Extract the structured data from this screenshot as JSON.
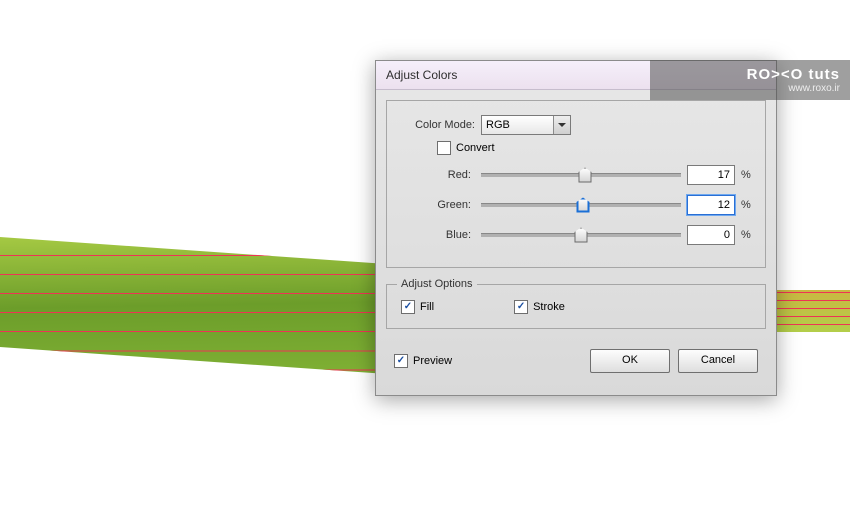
{
  "dialog": {
    "title": "Adjust Colors",
    "colorMode": {
      "label": "Color Mode:",
      "value": "RGB"
    },
    "convert": {
      "label": "Convert",
      "checked": false
    },
    "sliders": [
      {
        "label": "Red:",
        "value": "17",
        "thumbPct": 52
      },
      {
        "label": "Green:",
        "value": "12",
        "thumbPct": 51,
        "focused": true
      },
      {
        "label": "Blue:",
        "value": "0",
        "thumbPct": 50
      }
    ],
    "adjustOptions": {
      "legend": "Adjust Options",
      "fill": {
        "label": "Fill",
        "checked": true
      },
      "stroke": {
        "label": "Stroke",
        "checked": true
      }
    },
    "preview": {
      "label": "Preview",
      "checked": true
    },
    "buttons": {
      "ok": "OK",
      "cancel": "Cancel"
    }
  },
  "watermark": {
    "brand": "RO><O tuts",
    "url": "www.roxo.ir"
  },
  "pct": "%"
}
